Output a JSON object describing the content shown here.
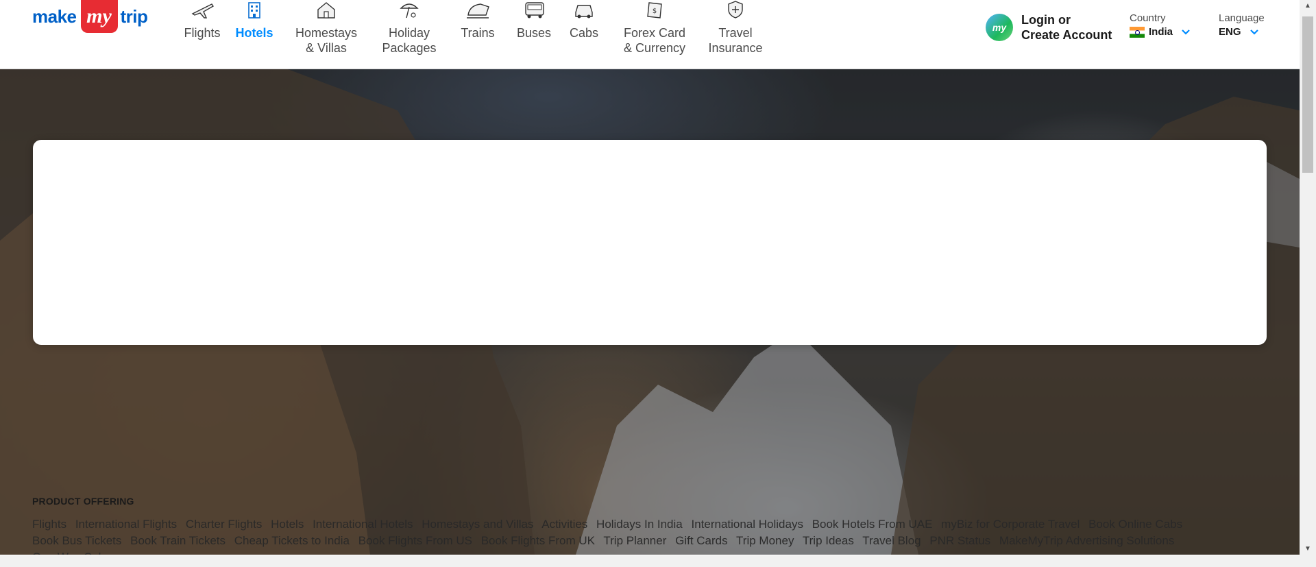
{
  "brand": {
    "left": "make",
    "badge": "my",
    "right": "trip"
  },
  "nav": [
    {
      "label": "Flights",
      "icon": "airplane-icon",
      "active": false
    },
    {
      "label": "Hotels",
      "icon": "hotel-building-icon",
      "active": true
    },
    {
      "label": "Homestays\n& Villas",
      "icon": "house-icon",
      "active": false
    },
    {
      "label": "Holiday\nPackages",
      "icon": "beach-umbrella-icon",
      "active": false
    },
    {
      "label": "Trains",
      "icon": "train-icon",
      "active": false
    },
    {
      "label": "Buses",
      "icon": "bus-icon",
      "active": false
    },
    {
      "label": "Cabs",
      "icon": "car-icon",
      "active": false
    },
    {
      "label": "Forex Card\n& Currency",
      "icon": "currency-note-icon",
      "active": false
    },
    {
      "label": "Travel\nInsurance",
      "icon": "shield-plus-icon",
      "active": false
    }
  ],
  "account": {
    "avatar": "my",
    "line1": "Login or",
    "line2": "Create Account"
  },
  "country": {
    "caption": "Country",
    "value": "India"
  },
  "language": {
    "caption": "Language",
    "value": "ENG"
  },
  "offering": {
    "heading": "PRODUCT OFFERING",
    "links": [
      "Flights",
      "International Flights",
      "Charter Flights",
      "Hotels",
      "International Hotels",
      "Homestays and Villas",
      "Activities",
      "Holidays In India",
      "International Holidays",
      "Book Hotels From UAE",
      "myBiz for Corporate Travel",
      "Book Online Cabs",
      "Book Bus Tickets",
      "Book Train Tickets",
      "Cheap Tickets to India",
      "Book Flights From US",
      "Book Flights From UK",
      "Trip Planner",
      "Gift Cards",
      "Trip Money",
      "Trip Ideas",
      "Travel Blog",
      "PNR Status",
      "MakeMyTrip Advertising Solutions",
      "One Way Cab"
    ]
  },
  "colors": {
    "brand_blue": "#0060c7",
    "brand_red": "#e72c33",
    "active_nav": "#008cff"
  }
}
